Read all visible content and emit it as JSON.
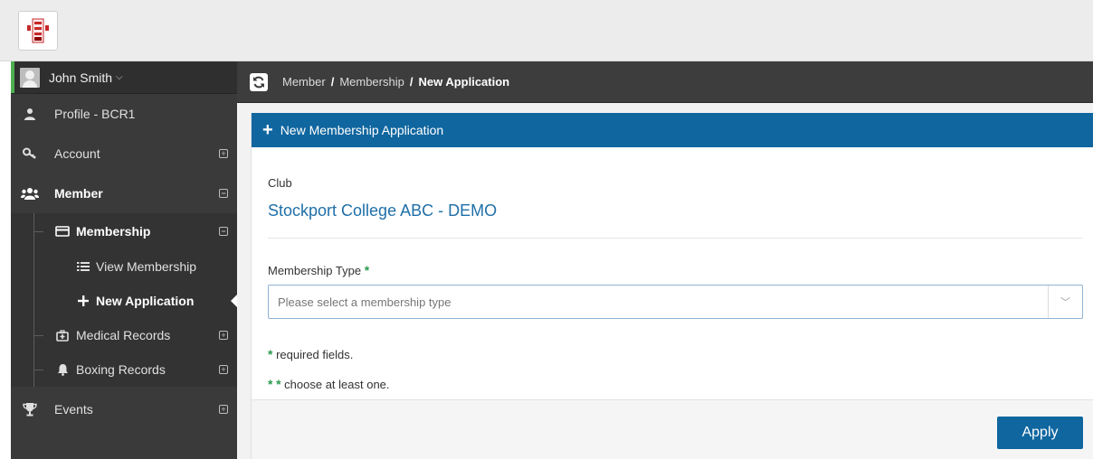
{
  "user": {
    "name": "John Smith"
  },
  "sidebar": {
    "items": [
      {
        "label": "Profile - BCR1"
      },
      {
        "label": "Account"
      },
      {
        "label": "Member"
      },
      {
        "label": "Events"
      }
    ],
    "member_sub": [
      {
        "label": "Membership"
      },
      {
        "label": "Medical Records"
      },
      {
        "label": "Boxing Records"
      }
    ],
    "membership_sub": [
      {
        "label": "View Membership"
      },
      {
        "label": "New Application"
      }
    ]
  },
  "breadcrumb": {
    "items": [
      "Member",
      "Membership",
      "New Application"
    ],
    "separator": "/"
  },
  "panel": {
    "title": "New Membership Application",
    "club_label": "Club",
    "club_name": "Stockport College ABC - DEMO",
    "membership_type_label": "Membership Type",
    "membership_type_placeholder": "Please select a membership type",
    "required_marker": "*",
    "required_note": "required fields.",
    "choose_note": "choose at least one.",
    "apply_label": "Apply"
  },
  "colors": {
    "accent": "#10669f",
    "required": "#2e9a4e",
    "sidebar_bg": "#3a3a3a",
    "user_indicator": "#4caf50"
  },
  "icons": {
    "refresh": "refresh-icon",
    "profile": "user-icon",
    "account": "key-icon",
    "member": "users-icon",
    "membership": "credit-card-icon",
    "view_membership": "list-icon",
    "new_application": "plus-icon",
    "medical": "medkit-icon",
    "boxing": "bell-icon",
    "events": "trophy-icon"
  }
}
